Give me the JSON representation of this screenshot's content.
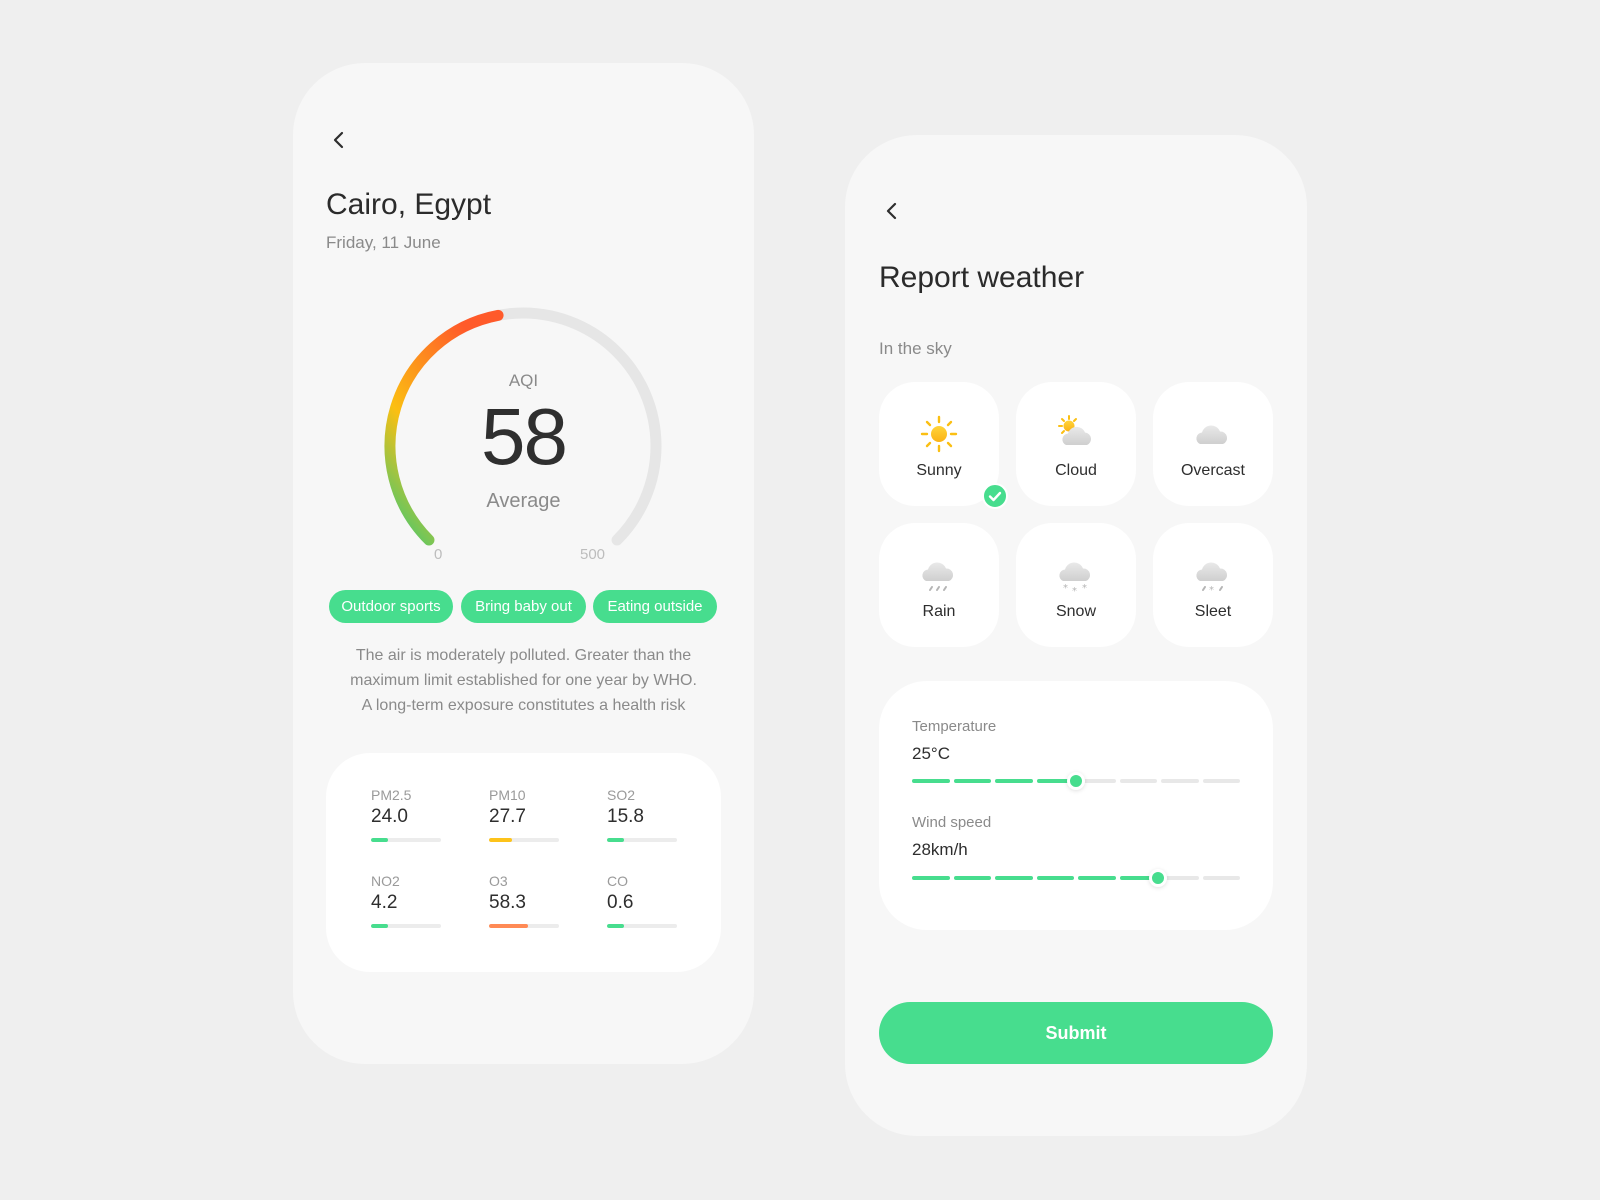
{
  "colors": {
    "accent": "#47dd8e",
    "background": "#efefef",
    "card": "#f7f7f7"
  },
  "air_quality": {
    "back_icon": "chevron-left-icon",
    "city": "Cairo, Egypt",
    "date": "Friday, 11 June",
    "gauge": {
      "label": "AQI",
      "value": "58",
      "status": "Average",
      "min_label": "0",
      "max_label": "500",
      "fill_fraction": 0.46
    },
    "chips": [
      "Outdoor sports",
      "Bring baby out",
      "Eating outside"
    ],
    "description": [
      "The air is moderately polluted. Greater than the",
      "maximum limit established for one year by WHO.",
      "A long-term exposure constitutes a health risk"
    ],
    "pollutants": [
      {
        "name": "PM2.5",
        "value": "24.0",
        "level": 0.24,
        "color": "#47dd8e"
      },
      {
        "name": "PM10",
        "value": "27.7",
        "level": 0.33,
        "color": "#fdc31a"
      },
      {
        "name": "SO2",
        "value": "15.8",
        "level": 0.24,
        "color": "#47dd8e"
      },
      {
        "name": "NO2",
        "value": "4.2",
        "level": 0.24,
        "color": "#47dd8e"
      },
      {
        "name": "O3",
        "value": "58.3",
        "level": 0.56,
        "color": "#ff8a55"
      },
      {
        "name": "CO",
        "value": "0.6",
        "level": 0.24,
        "color": "#47dd8e"
      }
    ]
  },
  "report": {
    "back_icon": "chevron-left-icon",
    "title": "Report weather",
    "section_label": "In the sky",
    "options": [
      {
        "label": "Sunny",
        "icon": "sun-icon",
        "selected": true
      },
      {
        "label": "Cloud",
        "icon": "partly-cloudy-icon",
        "selected": false
      },
      {
        "label": "Overcast",
        "icon": "cloud-icon",
        "selected": false
      },
      {
        "label": "Rain",
        "icon": "rain-icon",
        "selected": false
      },
      {
        "label": "Snow",
        "icon": "snow-icon",
        "selected": false
      },
      {
        "label": "Sleet",
        "icon": "sleet-icon",
        "selected": false
      }
    ],
    "temperature": {
      "label": "Temperature",
      "value": "25°C",
      "level": 0.5
    },
    "wind": {
      "label": "Wind speed",
      "value": "28km/h",
      "level": 0.75
    },
    "submit_label": "Submit"
  }
}
